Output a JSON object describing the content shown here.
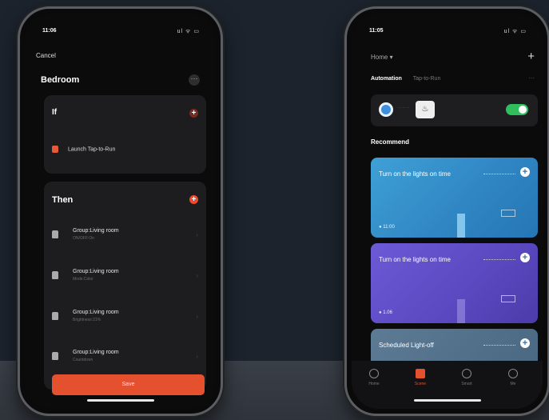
{
  "colors": {
    "accent": "#e5512f",
    "toggle_on": "#2fbf5d",
    "background": "#1c232d"
  },
  "left_phone": {
    "status_time": "11:06",
    "status_icons": "ul ᯤ ▭",
    "cancel": "Cancel",
    "title": "Bedroom",
    "more": "···",
    "if_card": {
      "title": "If",
      "condition": "Launch Tap-to-Run"
    },
    "then_card": {
      "title": "Then",
      "actions": [
        {
          "title": "Group:Living room",
          "subtitle": "ON/OFF:On"
        },
        {
          "title": "Group:Living room",
          "subtitle": "Mode:Color"
        },
        {
          "title": "Group:Living room",
          "subtitle": "Brightness:21%"
        },
        {
          "title": "Group:Living room",
          "subtitle": "Countdown"
        }
      ]
    },
    "save": "Save"
  },
  "right_phone": {
    "status_time": "11:05",
    "status_icons": "ul ᯤ ▭",
    "home_selector": "Home ▾",
    "add": "+",
    "tabs": [
      "Automation",
      "Tap-to-Run"
    ],
    "tabs_more": "···",
    "automation_dots": "·····",
    "automation_toggle": true,
    "recommend": "Recommend",
    "recommend_cards": [
      {
        "title": "Turn on the lights on time",
        "meta": "● 11:00",
        "color": "#3fa0d6"
      },
      {
        "title": "Turn on the lights on time",
        "meta": "● 1.06",
        "color": "#6c5ad6"
      },
      {
        "title": "Scheduled Light-off",
        "meta": "",
        "color": "#5d7b95"
      }
    ],
    "tabbar": [
      "Home",
      "Scene",
      "Smart",
      "Me"
    ]
  }
}
